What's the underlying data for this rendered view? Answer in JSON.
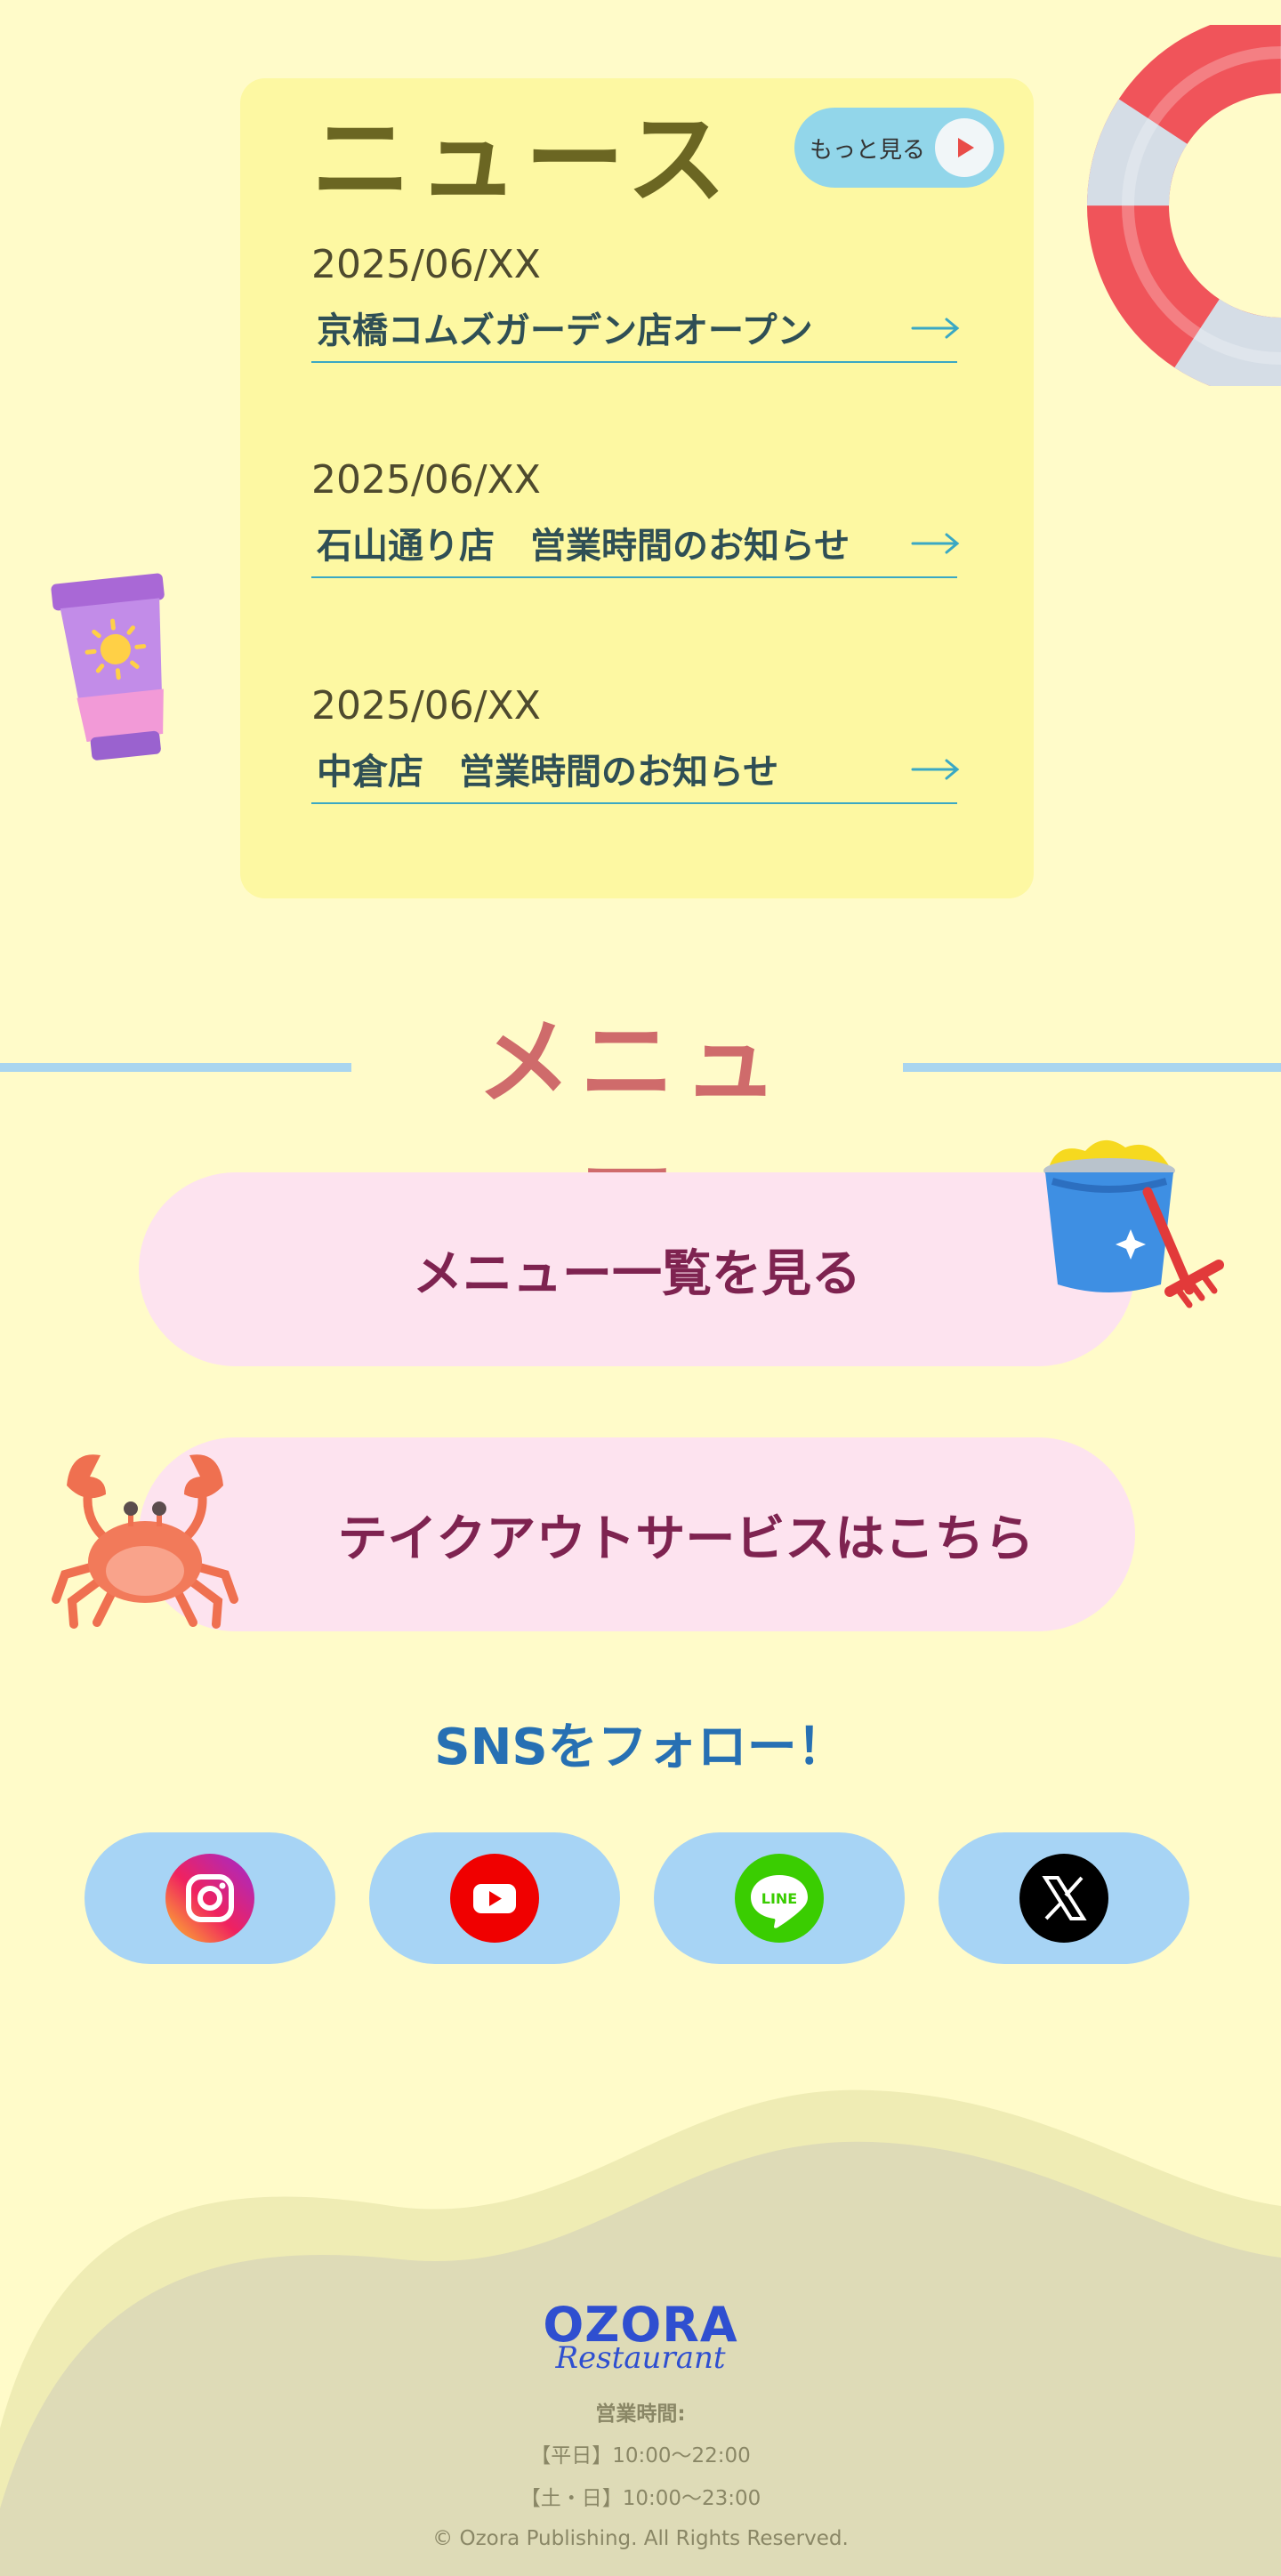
{
  "news": {
    "title": "ニュース",
    "more_label": "もっと見る",
    "items": [
      {
        "date": "2025/06/XX",
        "text": "京橋コムズガーデン店オープン"
      },
      {
        "date": "2025/06/XX",
        "text": "石山通り店　営業時間のお知らせ"
      },
      {
        "date": "2025/06/XX",
        "text": "中倉店　営業時間のお知らせ"
      }
    ]
  },
  "menu": {
    "title": "メニュー",
    "menu_list_label": "メニュー一覧を見る",
    "takeout_label": "テイクアウトサービスはこちら"
  },
  "sns": {
    "title": "SNSをフォロー！",
    "icons": [
      "instagram-icon",
      "youtube-icon",
      "line-icon",
      "x-icon"
    ],
    "line_text": "LINE"
  },
  "footer": {
    "logo_main": "OZORA",
    "logo_sub": "Restaurant",
    "hours_label": "営業時間:",
    "weekday": "【平日】10:00〜22:00",
    "weekend": "【土・日】10:00〜23:00",
    "copyright": "© Ozora Publishing. All Rights Reserved."
  },
  "colors": {
    "page_bg": "#fffbc9",
    "news_card": "#fdf8a2",
    "news_title": "#6b6622",
    "menu_title": "#cf6b6b",
    "pill_bg": "#fde3ef",
    "pill_text": "#7e2350",
    "sns_bg": "#a7d4f5",
    "sns_title": "#2770b3",
    "footer_bg": "#dedbb7",
    "logo": "#2f4fd0"
  }
}
